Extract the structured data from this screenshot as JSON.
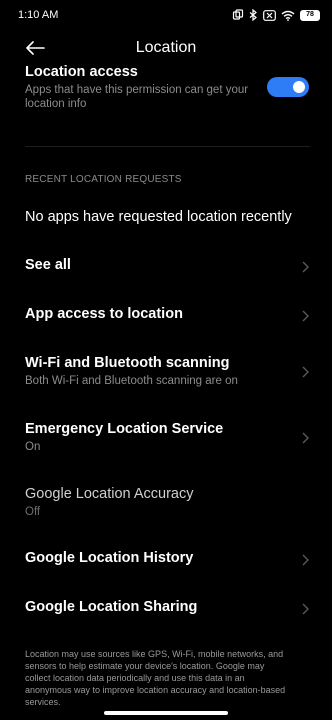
{
  "status_bar": {
    "time": "1:10 AM",
    "battery": "78",
    "icons": [
      "screen-record-icon",
      "bluetooth-icon",
      "close-box-icon",
      "wifi-icon",
      "battery-icon"
    ]
  },
  "header": {
    "title": "Location",
    "back_icon": "arrow-left-icon"
  },
  "location_access": {
    "title": "Location access",
    "subtitle": "Apps that have this permission can get your location info",
    "enabled": true,
    "accent_color": "#2e7cf6"
  },
  "recent": {
    "section_header": "RECENT LOCATION REQUESTS",
    "empty_text": "No apps have requested location recently"
  },
  "items": [
    {
      "title": "See all",
      "subtitle": ""
    },
    {
      "title": "App access to location",
      "subtitle": ""
    },
    {
      "title": "Wi-Fi and Bluetooth scanning",
      "subtitle": "Both Wi-Fi and Bluetooth scanning are on"
    },
    {
      "title": "Emergency Location Service",
      "subtitle": "On"
    },
    {
      "title": "Google Location Accuracy",
      "subtitle": "Off"
    },
    {
      "title": "Google Location History",
      "subtitle": ""
    },
    {
      "title": "Google Location Sharing",
      "subtitle": ""
    }
  ],
  "footer": {
    "text": "Location may use sources like GPS, Wi-Fi, mobile networks, and sensors to help estimate your device's location. Google may collect location data periodically and use this data in an anonymous way to improve location accuracy and location-based services."
  }
}
